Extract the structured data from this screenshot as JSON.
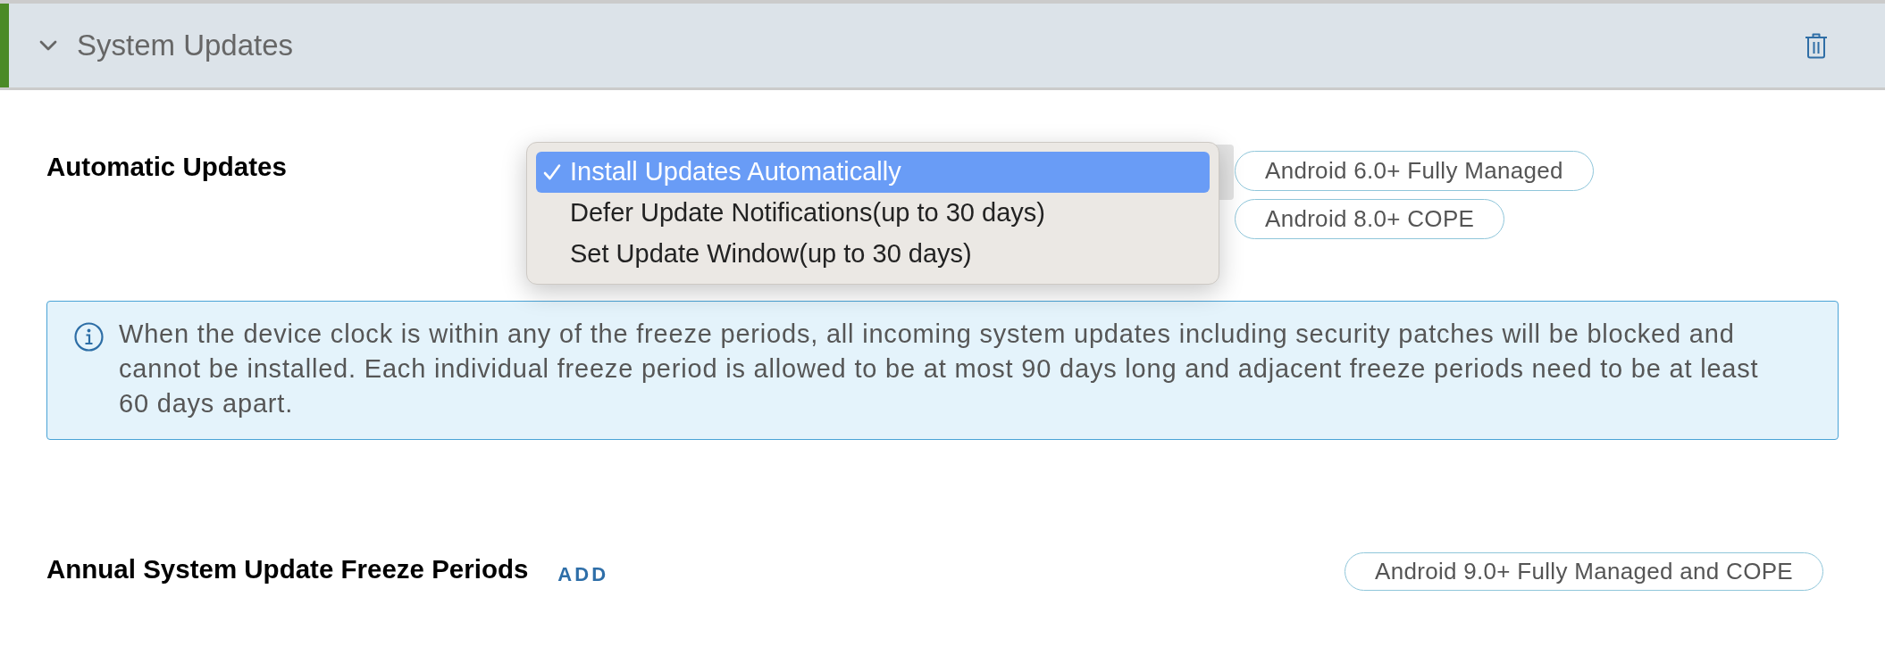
{
  "section": {
    "title": "System Updates",
    "expanded": true
  },
  "automatic_updates": {
    "label": "Automatic Updates",
    "options": [
      {
        "label": "Install Updates Automatically",
        "selected": true
      },
      {
        "label": "Defer Update Notifications(up to 30 days)",
        "selected": false
      },
      {
        "label": "Set Update Window(up to 30 days)",
        "selected": false
      }
    ],
    "badges": [
      "Android 6.0+ Fully Managed",
      "Android 8.0+ COPE"
    ]
  },
  "info": {
    "text": "When the device clock is within any of the freeze periods, all incoming system updates including security patches will be blocked and cannot be installed. Each individual freeze period is allowed to be at most 90 days long and adjacent freeze periods need to be at least 60 days apart."
  },
  "freeze_periods": {
    "label": "Annual System Update Freeze Periods",
    "action": "ADD",
    "badges": [
      "Android 9.0+ Fully Managed and COPE"
    ]
  }
}
